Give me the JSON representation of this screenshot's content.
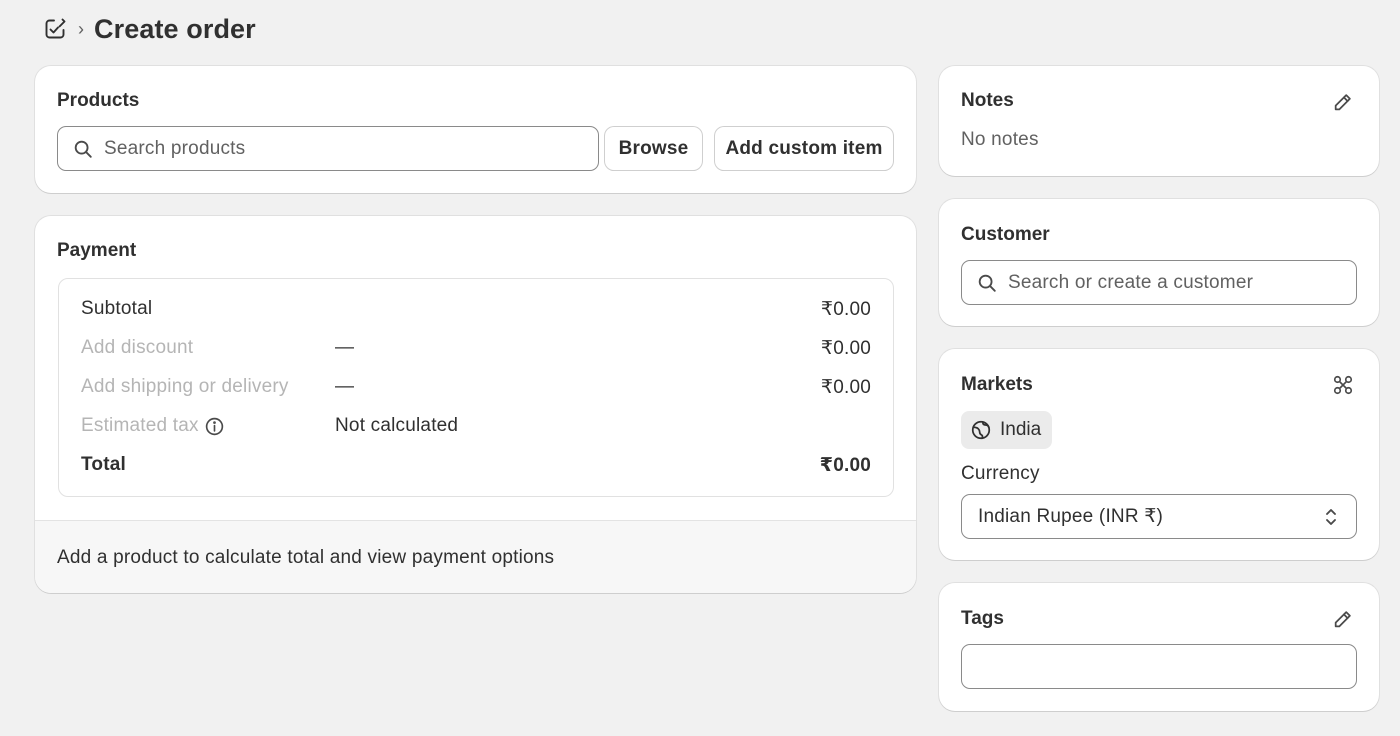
{
  "header": {
    "separator": "›",
    "title": "Create order"
  },
  "products": {
    "title": "Products",
    "search_placeholder": "Search products",
    "browse_label": "Browse",
    "add_custom_label": "Add custom item"
  },
  "payment": {
    "title": "Payment",
    "rows": [
      {
        "label": "Subtotal",
        "middle": "",
        "amount": "₹0.00"
      },
      {
        "label": "Add discount",
        "middle": "—",
        "amount": "₹0.00"
      },
      {
        "label": "Add shipping or delivery",
        "middle": "—",
        "amount": "₹0.00"
      },
      {
        "label": "Estimated tax",
        "middle": "Not calculated",
        "amount": ""
      },
      {
        "label": "Total",
        "middle": "",
        "amount": "₹0.00"
      }
    ],
    "footer": "Add a product to calculate total and view payment options"
  },
  "notes": {
    "title": "Notes",
    "value": "No notes"
  },
  "customer": {
    "title": "Customer",
    "search_placeholder": "Search or create a customer"
  },
  "markets": {
    "title": "Markets",
    "market": "India",
    "currency_label": "Currency",
    "currency_value": "Indian Rupee (INR ₹)"
  },
  "tags": {
    "title": "Tags",
    "value": ""
  },
  "icons": {
    "header": "orders-edit-icon",
    "search": "search-icon",
    "edit": "pencil-icon",
    "markets": "markets-icon",
    "globe": "globe-icon",
    "info": "info-icon",
    "select": "select-chevron-icon"
  }
}
